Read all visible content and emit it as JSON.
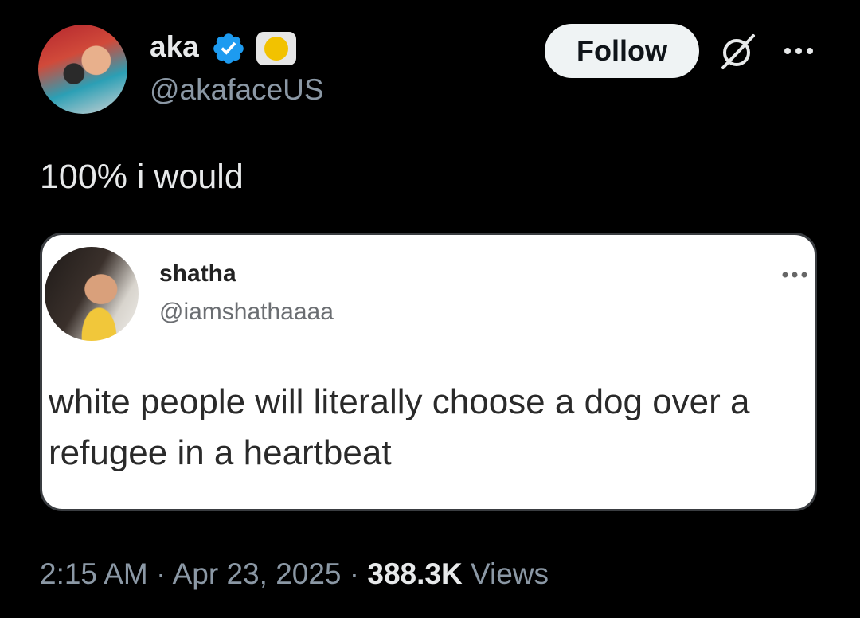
{
  "author": {
    "display_name": "aka",
    "handle": "@akafaceUS",
    "verified": true
  },
  "actions": {
    "follow_label": "Follow"
  },
  "tweet": {
    "text": "100% i would"
  },
  "quoted_tweet": {
    "display_name": "shatha",
    "handle": "@iamshathaaaa",
    "text": "white people will literally choose a dog over a refugee in a heartbeat"
  },
  "meta": {
    "time": "2:15 AM",
    "separator_1": "·",
    "date": "Apr 23, 2025",
    "separator_2": "·",
    "views_count": "388.3K",
    "views_label": "Views"
  },
  "colors": {
    "background": "#000000",
    "verified_blue": "#1d9bf0",
    "secondary_text": "#8b98a5"
  },
  "icons": [
    "verified-icon",
    "affiliate-badge-icon",
    "grok-icon",
    "more-icon"
  ]
}
